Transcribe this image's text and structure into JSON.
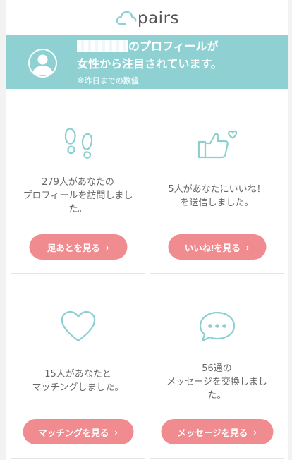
{
  "header": {
    "logo_text": "pairs"
  },
  "banner": {
    "line1_suffix": "のプロフィールが",
    "line2": "女性から注目されています。",
    "note": "※昨日までの数値"
  },
  "cards": [
    {
      "text_line1": "279人があなたの",
      "text_line2": "プロフィールを訪問しまし",
      "text_line3": "た。",
      "button": "足あとを見る"
    },
    {
      "text_line1": "5人があなたにいいね！",
      "text_line2": "を送信しました。",
      "button": "いいね!を見る"
    },
    {
      "text_line1": "15人があなたと",
      "text_line2": "マッチングしました。",
      "button": "マッチングを見る"
    },
    {
      "text_line1": "56通の",
      "text_line2": "メッセージを交換しまし",
      "text_line3": "た。",
      "button": "メッセージを見る"
    }
  ],
  "chevron": "›",
  "colors": {
    "teal": "#8fd1d3",
    "pink": "#f08b8f",
    "icon_teal": "#8ccfd0"
  },
  "icons": [
    "footprints-icon",
    "thumbs-up-heart-icon",
    "heart-icon",
    "speech-bubble-icon"
  ]
}
